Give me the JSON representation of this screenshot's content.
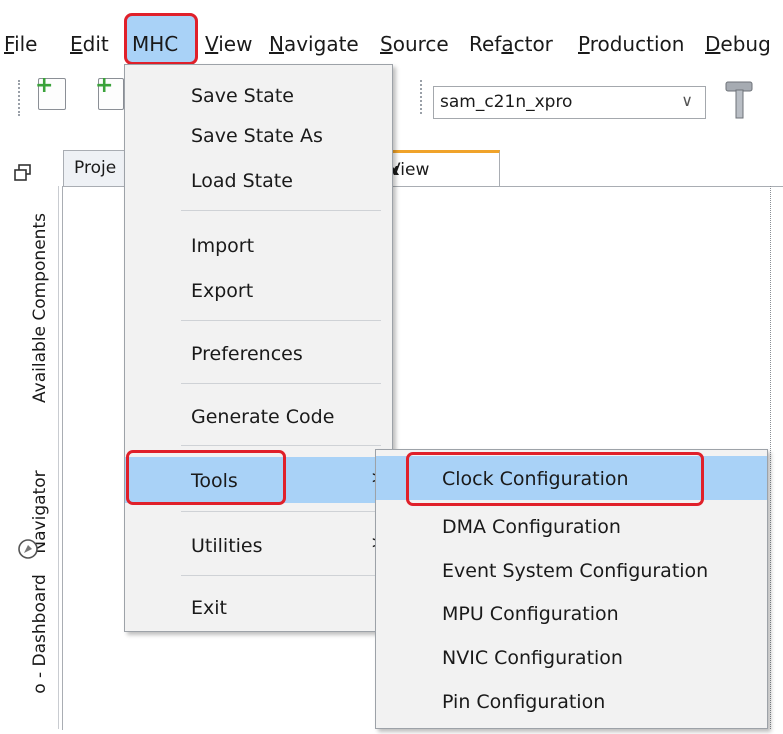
{
  "menubar": {
    "items": [
      {
        "label": "File",
        "u": "F",
        "rest": "ile"
      },
      {
        "label": "Edit",
        "u": "E",
        "rest": "dit"
      },
      {
        "label": "MHC"
      },
      {
        "label": "View",
        "u": "V",
        "rest": "iew"
      },
      {
        "label": "Navigate",
        "u": "N",
        "rest": "avigate"
      },
      {
        "label": "Source",
        "u": "S",
        "rest": "ource"
      },
      {
        "label": "Refactor",
        "pre": "Ref",
        "u": "a",
        "rest": "ctor"
      },
      {
        "label": "Production",
        "u": "P",
        "rest": "roduction"
      },
      {
        "label": "Debug",
        "u": "D",
        "rest": "ebug"
      }
    ]
  },
  "toolbar": {
    "config_combo": {
      "value": "sam_c21n_xpro"
    }
  },
  "left_strip": {
    "labels": [
      "Available Components",
      "Navigator",
      "o - Dashboard"
    ]
  },
  "tabs": [
    {
      "label": "Proje"
    },
    {
      "label": "View"
    }
  ],
  "mhc_menu": {
    "items": [
      {
        "label": "Save State"
      },
      {
        "label": "Save State As"
      },
      {
        "label": "Load State"
      },
      {
        "label": "Import"
      },
      {
        "label": "Export"
      },
      {
        "label": "Preferences"
      },
      {
        "label": "Generate Code"
      },
      {
        "label": "Tools",
        "submenu": true,
        "highlighted": true
      },
      {
        "label": "Utilities",
        "submenu": true
      },
      {
        "label": "Exit"
      }
    ]
  },
  "tools_submenu": {
    "items": [
      {
        "label": "Clock Configuration",
        "highlighted": true
      },
      {
        "label": "DMA Configuration"
      },
      {
        "label": "Event System Configuration"
      },
      {
        "label": "MPU Configuration"
      },
      {
        "label": "NVIC Configuration"
      },
      {
        "label": "Pin Configuration"
      }
    ]
  },
  "glyphs": {
    "submenu_arrow": ">",
    "chevron": "∨",
    "close": "x"
  },
  "colors": {
    "highlight": "#a9d2f7",
    "callout": "#e0202a",
    "active_tab": "#f0a32a"
  }
}
